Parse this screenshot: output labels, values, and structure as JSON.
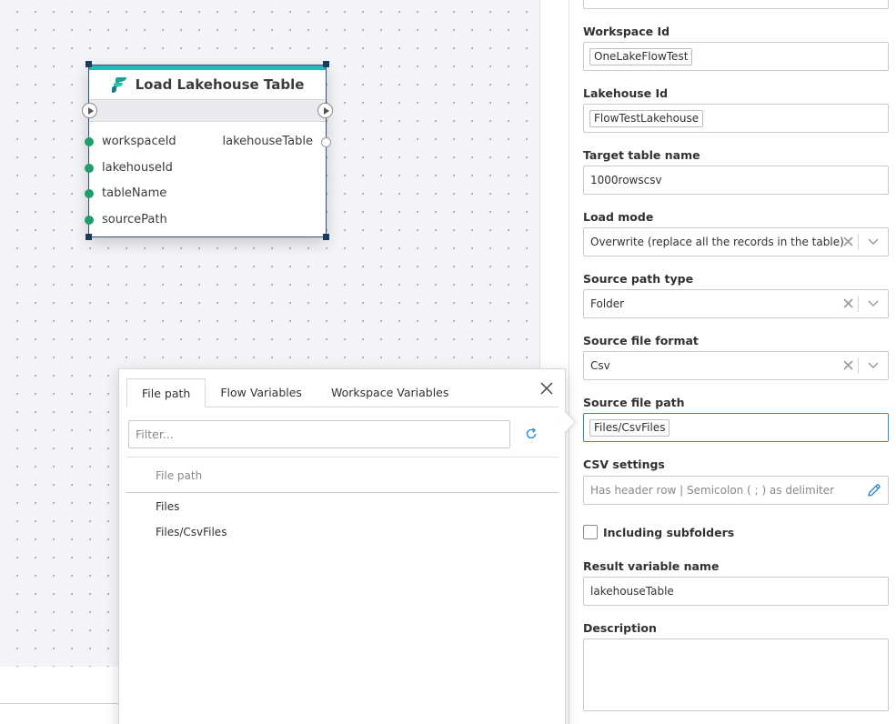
{
  "node": {
    "title": "Load Lakehouse Table",
    "params": [
      "workspaceId",
      "lakehouseId",
      "tableName",
      "sourcePath"
    ],
    "output": "lakehouseTable"
  },
  "picker": {
    "tabs": [
      "File path",
      "Flow Variables",
      "Workspace Variables"
    ],
    "active_tab": "File path",
    "filter_placeholder": "Filter...",
    "column_header": "File path",
    "items": [
      "Files",
      "Files/CsvFiles"
    ]
  },
  "panel": {
    "workspace_id": {
      "label": "Workspace Id",
      "value": "OneLakeFlowTest"
    },
    "lakehouse_id": {
      "label": "Lakehouse Id",
      "value": "FlowTestLakehouse"
    },
    "target_table": {
      "label": "Target table name",
      "value": "1000rowscsv"
    },
    "load_mode": {
      "label": "Load mode",
      "value": "Overwrite (replace all the records in the table)"
    },
    "source_path_type": {
      "label": "Source path type",
      "value": "Folder"
    },
    "source_file_format": {
      "label": "Source file format",
      "value": "Csv"
    },
    "source_file_path": {
      "label": "Source file path",
      "value": "Files/CsvFiles"
    },
    "csv_settings": {
      "label": "CSV settings",
      "value": "Has header row | Semicolon ( ; ) as delimiter"
    },
    "include_subfolders": {
      "label": "Including subfolders",
      "checked": false
    },
    "result_variable": {
      "label": "Result variable name",
      "value": "lakehouseTable"
    },
    "description": {
      "label": "Description",
      "value": ""
    }
  },
  "colors": {
    "accent": "#27b7b7",
    "port_connected": "#1e9e6b",
    "focus": "#2a8dd4",
    "node_border": "#2f5275",
    "refresh_icon": "#2a8dd4"
  },
  "icons": [
    "fabric-logo-icon",
    "exec-in-icon",
    "exec-out-icon",
    "close-icon",
    "refresh-icon",
    "clear-icon",
    "chevron-down-icon",
    "pencil-icon"
  ]
}
